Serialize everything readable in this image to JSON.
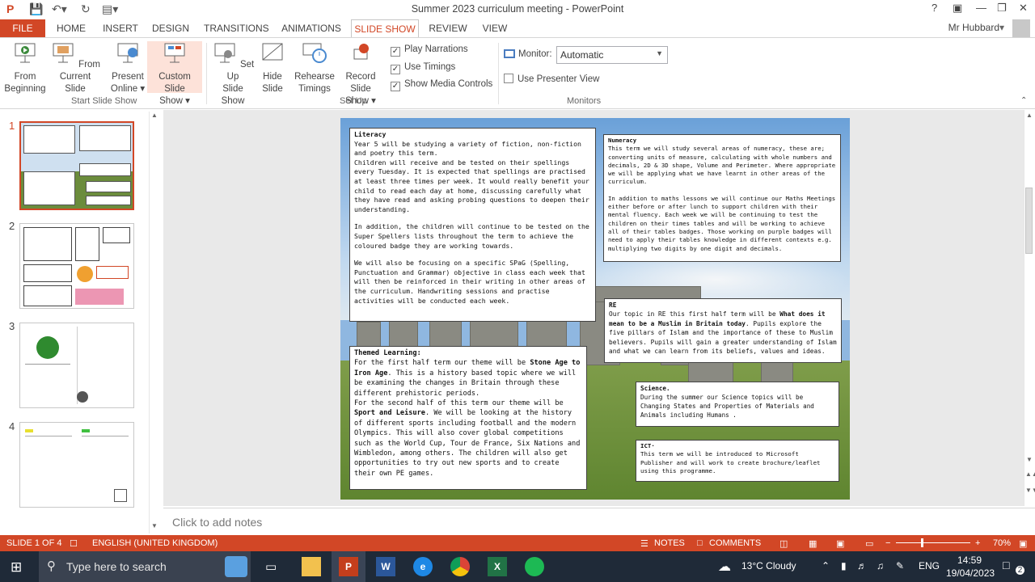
{
  "window": {
    "title": "Summer  2023 curriculum meeting - PowerPoint",
    "help": "?",
    "user": "Mr Hubbard"
  },
  "tabs": [
    "FILE",
    "HOME",
    "INSERT",
    "DESIGN",
    "TRANSITIONS",
    "ANIMATIONS",
    "SLIDE SHOW",
    "REVIEW",
    "VIEW"
  ],
  "ribbon": {
    "start": {
      "from_beginning": [
        "From",
        "Beginning"
      ],
      "from_current": [
        "From",
        "Current Slide"
      ],
      "present_online": [
        "Present",
        "Online ▾"
      ],
      "custom_show": [
        "Custom Slide",
        "Show ▾"
      ],
      "label": "Start Slide Show"
    },
    "setup": {
      "setup_show": [
        "Set Up",
        "Slide Show"
      ],
      "hide_slide": [
        "Hide",
        "Slide"
      ],
      "rehearse": [
        "Rehearse",
        "Timings"
      ],
      "record": [
        "Record Slide",
        "Show ▾"
      ],
      "play_narrations": "Play Narrations",
      "use_timings": "Use Timings",
      "show_media": "Show Media Controls",
      "label": "Set Up"
    },
    "monitors": {
      "monitor_label": "Monitor:",
      "monitor_value": "Automatic",
      "presenter_view": "Use Presenter View",
      "label": "Monitors"
    }
  },
  "thumbnails": [
    "1",
    "2",
    "3",
    "4"
  ],
  "slide": {
    "literacy": {
      "title": "Literacy",
      "p1": "Year 5 will be studying a variety of fiction, non-fiction and poetry this term.",
      "p2": "Children will receive and be tested on their spellings every Tuesday. It is expected that spellings are practised at least three times per week. It would really benefit your child to read each day at home, discussing carefully what they have read and asking probing questions to deepen their understanding.",
      "p3": "In addition, the children will continue to be tested on the Super Spellers lists throughout the term to achieve the coloured badge they are working towards.",
      "p4": "We will also be focusing on a specific SPaG (Spelling, Punctuation and Grammar) objective in class each week that will then be reinforced in their writing in other areas of the curriculum. Handwriting sessions and practise activities will be conducted each week."
    },
    "numeracy": {
      "title": "Numeracy",
      "p1": "This term we will study several areas of numeracy, these are; converting units of measure, calculating with whole numbers and decimals, 2D & 3D shape, Volume and Perimeter. Where appropriate we will be applying what we have learnt in other areas of the curriculum.",
      "p2": "In addition to maths lessons we will continue our Maths Meetings either before or after lunch to support children with their mental fluency. Each week we will be continuing to test the children on their times tables and will be working to achieve all of their tables badges. Those working on purple badges will need to apply their tables knowledge in different contexts e.g. multiplying two digits by one digit and decimals."
    },
    "re": {
      "title": "RE",
      "a": "Our topic in RE this first half term will be ",
      "b": "What does it mean to be a Muslim in Britain today",
      "c": ". Pupils explore the five pillars of Islam and the importance of these to Muslim believers. Pupils will gain a greater understanding of Islam and what we can learn from its beliefs, values and ideas."
    },
    "themed": {
      "title": "Themed Learning:",
      "a": "For the first half term our theme will be ",
      "b": "Stone Age to Iron Age",
      "c": ". This is a history based topic where we will be examining the changes in Britain through these different prehistoric periods.",
      "d": "For the second half of this term our theme will be ",
      "e": "Sport and Leisure",
      "f": ". We will be looking at the history of different sports including football and the modern Olympics. This will also cover global competitions such as the World Cup, Tour de France, Six Nations and Wimbledon, among others. The children will also get opportunities to try out new sports and to create their own PE games."
    },
    "science": {
      "title": "Science.",
      "p1": "During the summer our Science topics will be Changing States and Properties of Materials and Animals including Humans ."
    },
    "ict": {
      "title": "ICT·",
      "p1": "This term we will be introduced to Microsoft Publisher and will work to create brochure/leaflet using this programme."
    }
  },
  "notes_placeholder": "Click to add notes",
  "status": {
    "slide": "SLIDE 1 OF 4",
    "language": "ENGLISH (UNITED KINGDOM)",
    "notes": "NOTES",
    "comments": "COMMENTS",
    "zoom": "70%"
  },
  "taskbar": {
    "search": "Type here to search",
    "weather": "13°C  Cloudy",
    "lang": "ENG",
    "time": "14:59",
    "date": "19/04/2023",
    "notif": "2"
  },
  "colors": {
    "accent": "#d24726",
    "taskbar": "#1f2a38"
  }
}
